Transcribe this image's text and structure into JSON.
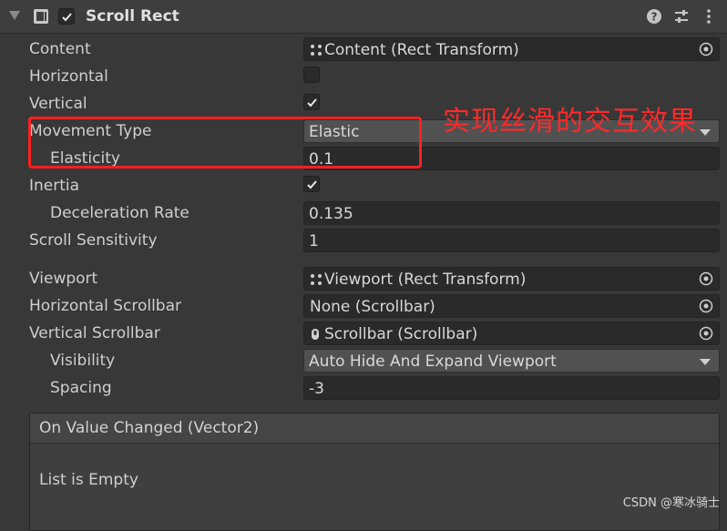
{
  "header": {
    "title": "Scroll Rect",
    "enabled": true,
    "icons": [
      "help-icon",
      "presets-icon",
      "more-icon"
    ]
  },
  "fields": {
    "content": {
      "label": "Content",
      "value": "Content (Rect Transform)"
    },
    "horizontal": {
      "label": "Horizontal",
      "checked": false
    },
    "vertical": {
      "label": "Vertical",
      "checked": true
    },
    "movement_type": {
      "label": "Movement Type",
      "value": "Elastic"
    },
    "elasticity": {
      "label": "Elasticity",
      "value": "0.1"
    },
    "inertia": {
      "label": "Inertia",
      "checked": true
    },
    "deceleration_rate": {
      "label": "Deceleration Rate",
      "value": "0.135"
    },
    "scroll_sensitivity": {
      "label": "Scroll Sensitivity",
      "value": "1"
    },
    "viewport": {
      "label": "Viewport",
      "value": "Viewport (Rect Transform)"
    },
    "horizontal_scrollbar": {
      "label": "Horizontal Scrollbar",
      "value": "None (Scrollbar)"
    },
    "vertical_scrollbar": {
      "label": "Vertical Scrollbar",
      "value": "Scrollbar (Scrollbar)"
    },
    "visibility": {
      "label": "Visibility",
      "value": "Auto Hide And Expand Viewport"
    },
    "spacing": {
      "label": "Spacing",
      "value": "-3"
    }
  },
  "event": {
    "title": "On Value Changed (Vector2)",
    "empty_text": "List is Empty"
  },
  "annotation": {
    "text": "实现丝滑的交互效果",
    "color": "#ff2a2a"
  },
  "watermark": "CSDN @寒冰骑士"
}
